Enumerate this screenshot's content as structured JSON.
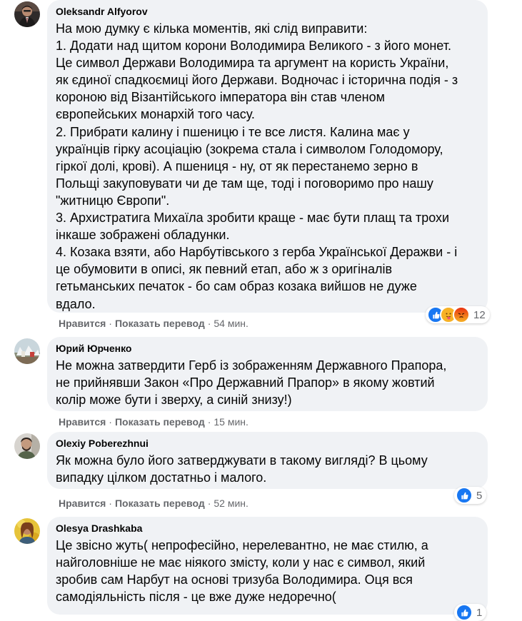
{
  "comments": [
    {
      "author": "Oleksandr Alfyorov",
      "text": "На мою думку є кілька моментів, які слід виправити:\n1. Додати над щитом корони Володимира Великого - з його монет.\nЦе символ Держави Володимира та аргумент на користь України,\nяк єдиної спадкоємиці його Держави. Водночас і історична подія - з\nкороною від Візантійського імператора він став членом\nєвропейських монархій того часу.\n2. Прибрати калину і пшеницю і те все листя. Калина має у\nукраїнців гірку асоціацію (зокрема стала і символом Голодомору,\nгіркої долі, крові). А пшениця - ну, от як перестанемо зерно в\nПольщі закуповувати чи де там ще, тоді і поговоримо про нашу\n\"житницю Європи\".\n3. Архистратига Михаїла зробити краще - має бути плащ та трохи\nінкаше зображені обладунки.\n4. Козака взяти, або Нарбутівського з герба Української Деражви - і\nце обумовити в описі, як певний етап, або ж з оригіналів\nгетьманських печаток - бо сам образ козака вийшов не дуже\nвдало.",
      "like": "Нравится",
      "translate": "Показать перевод",
      "time": "54 мин.",
      "reactions": [
        "like",
        "care",
        "angry"
      ],
      "reaction_count": "12"
    },
    {
      "author": "Юрий Юрченко",
      "text": "Не можна затвердити Герб із зображенням Державного Прапора,\nне прийнявши Закон «Про Державний Прапор» в якому жовтий\nколір може бути і зверху, а синій знизу!)",
      "like": "Нравится",
      "translate": "Показать перевод",
      "time": "15 мин.",
      "reactions": [],
      "reaction_count": ""
    },
    {
      "author": "Olexiy Poberezhnui",
      "text": "Як можна було його затверджувати в такому вигляді? В цьому\nвипадку цілком достатньо і малого.",
      "like": "Нравится",
      "translate": "Показать перевод",
      "time": "52 мин.",
      "reactions": [
        "like"
      ],
      "reaction_count": "5"
    },
    {
      "author": "Olesya Drashkaba",
      "text": "Це звісно жуть( непрофесійно, нерелевантно, не має стилю, а\nнайголовніше не має ніякого змісту, коли у нас є символ, який\nзробив сам Нарбут на основі тризуба Володимира. Оця вся\nсамодіяльність після - це вже дуже недоречно(",
      "like": "",
      "translate": "",
      "time": "",
      "reactions": [
        "like"
      ],
      "reaction_count": "1"
    }
  ],
  "colors": {
    "bubble": "#f0f2f5",
    "like_blue": "#1877f2",
    "meta_gray": "#65676b",
    "angry_orange": "#e9710f",
    "care_yellow": "#f7b125"
  }
}
